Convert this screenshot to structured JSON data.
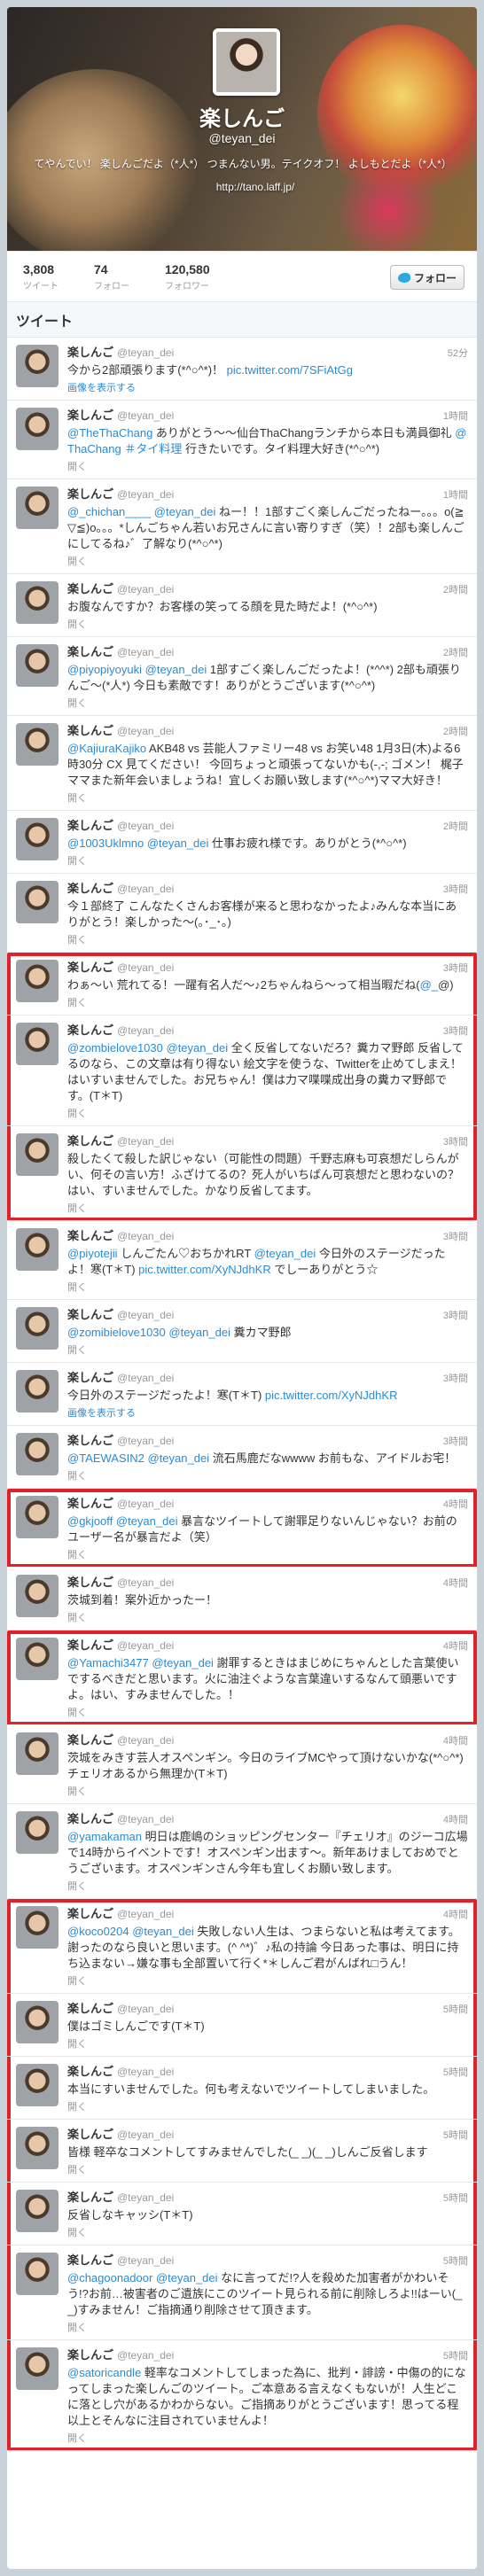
{
  "profile": {
    "name": "楽しんご",
    "screen_name": "@teyan_dei",
    "bio": "てやんでい！ 楽しんごだよ（*人*） つまんない男。テイクオフ！ よしもとだよ（*人*）",
    "url": "http://tano.laff.jp/",
    "stats": [
      {
        "value": "3,808",
        "label": "ツイート"
      },
      {
        "value": "74",
        "label": "フォロー"
      },
      {
        "value": "120,580",
        "label": "フォロワー"
      }
    ],
    "follow_label": "フォロー"
  },
  "tweets_heading": "ツイート",
  "actions": {
    "open": "開く",
    "media": "画像を表示する"
  },
  "tweets": [
    {
      "time": "52分",
      "text": "今から2部頑張ります(*^○^*)！ pic.twitter.com/7SFiAtGg",
      "action": "画像を表示する"
    },
    {
      "time": "1時間",
      "text": "@TheThaChang ありがとう〜〜仙台ThaChangランチから本日も満員御礼 @ThaChang ＃タイ料理 行きたいです。タイ料理大好き(*^○^*)",
      "action": "開く"
    },
    {
      "time": "1時間",
      "text": "@_chichan____ @teyan_dei ねー！！1部すごく楽しんごだったねー。。。o(≧▽≦)o。。。*しんごちゃん若いお兄さんに言い寄りすぎ（笑）！2部も楽しんごにしてるね♪゛了解なり(*^○^*)",
      "action": "開く"
    },
    {
      "time": "2時間",
      "text": "お腹なんですか？お客様の笑ってる顔を見た時だよ！(*^○^*)",
      "action": "開く"
    },
    {
      "time": "2時間",
      "text": "@piyopiyoyuki @teyan_dei 1部すごく楽しんごだったよ！(*^^*) 2部も頑張りんご〜(*人*) 今日も素敵です！ありがとうございます(*^○^*)",
      "action": "開く"
    },
    {
      "time": "2時間",
      "text": "@KajiuraKajiko AKB48 vs 芸能人ファミリー48 vs お笑い48 1月3日(木)よる6時30分 CX 見てください！ 今回ちょっと頑張ってないかも(-,-; ゴメン！ 梶子ママまた新年会いましょうね！宜しくお願い致します(*^○^*)ママ大好き！",
      "action": "開く"
    },
    {
      "time": "2時間",
      "text": "@1003Uklmno @teyan_dei 仕事お疲れ様です。ありがとう(*^○^*)",
      "action": "開く"
    },
    {
      "time": "3時間",
      "text": "今１部終了 こんなたくさんお客様が来ると思わなかったよ♪みんな本当にありがとう！楽しかった〜(｡･_･｡)",
      "action": "開く"
    },
    {
      "time": "3時間",
      "text": "わぁ〜い 荒れてる！一躍有名人だ〜♪2ちゃんねら〜って相当暇だね(@_@)",
      "action": "開く",
      "box": 1
    },
    {
      "time": "3時間",
      "text": "@zombielove1030 @teyan_dei 全く反省してないだろ？糞カマ野郎 反省してるのなら、この文章は有り得ない 絵文字を使うな、Twitterを止めてしまえ！はいすいませんでした。お兄ちゃん！僕は力マ喋喋成出身の糞カマ野郎です。(T＊T)",
      "action": "開く",
      "box": 1
    },
    {
      "time": "3時間",
      "text": "殺したくて殺した訳じゃない（可能性の問題）千野志麻も可哀想だしらんがい、何その言い方！ふざけてるの？死人がいちばん可哀想だと思わないの？ はい、すいませんでした。かなり反省してます。",
      "action": "開く",
      "box": 1
    },
    {
      "time": "3時間",
      "text": "@piyotejii しんごたん♡おちかれRT @teyan_dei 今日外のステージだったよ！寒(T＊T) pic.twitter.com/XyNJdhKR でしーありがとう☆",
      "action": "開く"
    },
    {
      "time": "3時間",
      "text": "@zomibielove1030 @teyan_dei 糞カマ野郎",
      "action": "開く"
    },
    {
      "time": "3時間",
      "text": "今日外のステージだったよ！寒(T＊T) pic.twitter.com/XyNJdhKR",
      "action": "画像を表示する"
    },
    {
      "time": "3時間",
      "text": "@TAEWASIN2 @teyan_dei 流石馬鹿だなwwww お前もな、アイドルお宅！",
      "action": "開く"
    },
    {
      "time": "4時間",
      "text": "@gkjooff @teyan_dei 暴言なツイートして謝罪足りないんじゃない？お前のユーザー名が暴言だよ（笑）",
      "action": "開く",
      "box": 2
    },
    {
      "time": "4時間",
      "text": "茨城到着！案外近かったー！",
      "action": "開く"
    },
    {
      "time": "4時間",
      "text": "@Yamachi3477 @teyan_dei 謝罪するときはまじめにちゃんとした言葉使いでするべきだと思います。火に油注ぐような言葉違いするなんて頭悪いですよ。はい、すみませんでした。！",
      "action": "開く",
      "box": 3
    },
    {
      "time": "4時間",
      "text": "茨城をみきす芸人オスペンギン。今日のライブMCやって頂けないかな(*^○^*)チェリオあるから無理か(T＊T)",
      "action": "開く"
    },
    {
      "time": "4時間",
      "text": "@yamakaman 明日は鹿嶋のショッピングセンター『チェリオ』のジーコ広場で14時からイベントです！オスペンギン出ます〜。新年あけましておめでとうございます。オスペンギンさん今年も宜しくお願い致します。",
      "action": "開く"
    },
    {
      "time": "4時間",
      "text": "@koco0204 @teyan_dei 失敗しない人生は、つまらないと私は考えてます。謝ったのなら良いと思います。(^ ^*)゛♪私の持論 今日あった事は、明日に持ち込まない→嫌な事も全部置いて行く*＊しんご君がんばれ□うん！",
      "action": "開く",
      "box": 4
    },
    {
      "time": "5時間",
      "text": "僕はゴミしんごです(T＊T)",
      "action": "開く",
      "box": 4
    },
    {
      "time": "5時間",
      "text": "本当にすいませんでした。何も考えないでツイートしてしまいました。",
      "action": "開く",
      "box": 4
    },
    {
      "time": "5時間",
      "text": "皆様 軽卒なコメントしてすみませんでした(_ _)(_ _)しんご反省します",
      "action": "開く",
      "box": 4
    },
    {
      "time": "5時間",
      "text": "反省しなキャッシ(T＊T)",
      "action": "開く",
      "box": 4
    },
    {
      "time": "5時間",
      "text": "@chagoonadoor @teyan_dei なに言ってだ!?人を殺めた加害者がかわいそう!?お前…被害者のご遺族にこのツイート見られる前に削除しろよ!!はーい(_ _)すみません！ご指摘通り削除させて頂きます。",
      "action": "開く",
      "box": 4
    },
    {
      "time": "5時間",
      "text": "@satoricandle 軽率なコメントしてしまった為に、批判・誹謗・中傷の的になってしまった楽しんごのツイート。ご本意ある言えなくもないが！人生どこに落とし穴があるかわからない。ご指摘ありがとうございます！思ってる程以上とそんなに注目されていませんよ！",
      "action": "開く",
      "box": 4
    }
  ]
}
